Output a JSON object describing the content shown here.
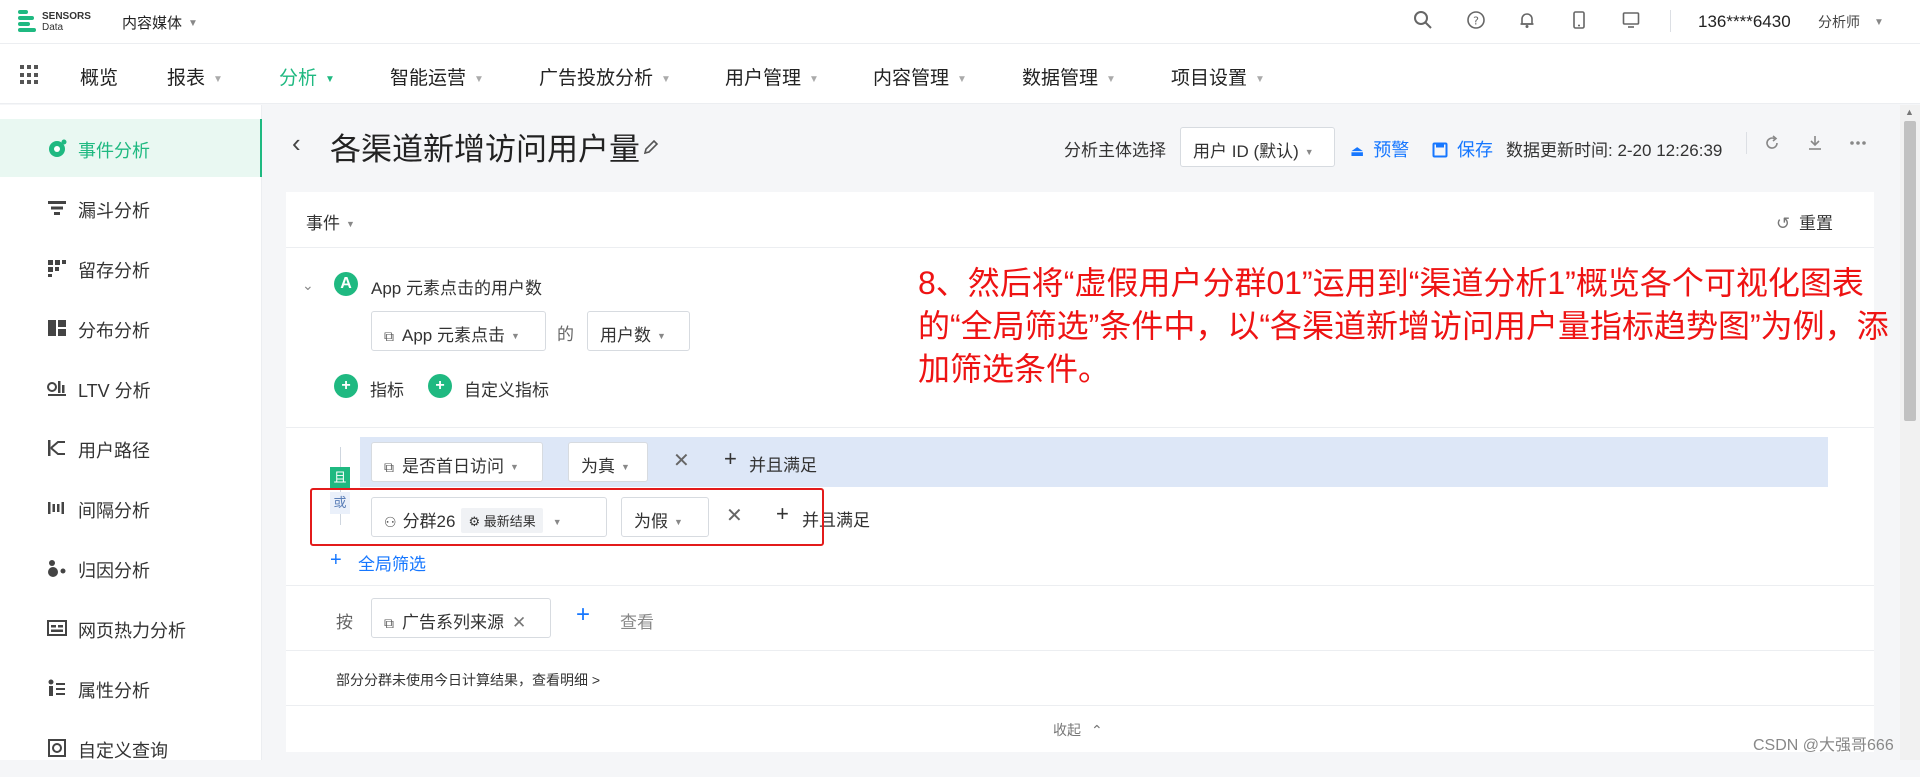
{
  "topbar": {
    "logo_line1": "SENSORS",
    "logo_line2": "Data",
    "project": "内容媒体",
    "user": "136****6430",
    "role": "分析师",
    "icons": [
      "search-icon",
      "help-icon",
      "bell-icon",
      "mobile-icon",
      "monitor-icon"
    ]
  },
  "nav": {
    "items": [
      "概览",
      "报表",
      "分析",
      "智能运营",
      "广告投放分析",
      "用户管理",
      "内容管理",
      "数据管理",
      "项目设置"
    ],
    "active": "分析"
  },
  "sidebar": {
    "items": [
      "事件分析",
      "漏斗分析",
      "留存分析",
      "分布分析",
      "LTV 分析",
      "用户路径",
      "间隔分析",
      "归因分析",
      "网页热力分析",
      "属性分析",
      "自定义查询"
    ],
    "active": "事件分析"
  },
  "header": {
    "title": "各渠道新增访问用户量",
    "subject_label": "分析主体选择",
    "subject_value": "用户 ID (默认)",
    "warn": "预警",
    "save": "保存",
    "update_time": "数据更新时间: 2-20 12:26:39"
  },
  "card": {
    "event_label": "事件",
    "reset": "重置",
    "metric_letter": "A",
    "metric_name": "App 元素点击的用户数",
    "event_select": "App 元素点击",
    "of": "的",
    "measure_select": "用户数",
    "add_metric": "指标",
    "add_custom_metric": "自定义指标",
    "and_tag": "且",
    "or_tag": "或",
    "filter1": {
      "field": "是否首日访问",
      "op": "为真",
      "and": "并且满足"
    },
    "filter2": {
      "field": "分群26",
      "badge": "最新结果",
      "op": "为假",
      "and": "并且满足"
    },
    "global_filter": "全局筛选",
    "by_label": "按",
    "by_select": "广告系列来源",
    "view": "查看",
    "hint": "部分分群未使用今日计算结果，查看明细 >",
    "collapse": "收起"
  },
  "annotation": "8、然后将“虚假用户分群01”运用到“渠道分析1”概览各个可视化图表的“全局筛选”条件中，以“各渠道新增访问用户量指标趋势图”为例，添加筛选条件。",
  "watermark": "CSDN @大强哥666",
  "colors": {
    "brand": "#1fb981",
    "link": "#1677ff",
    "annotation": "#ee1313",
    "highlight": "#e31b1b"
  }
}
